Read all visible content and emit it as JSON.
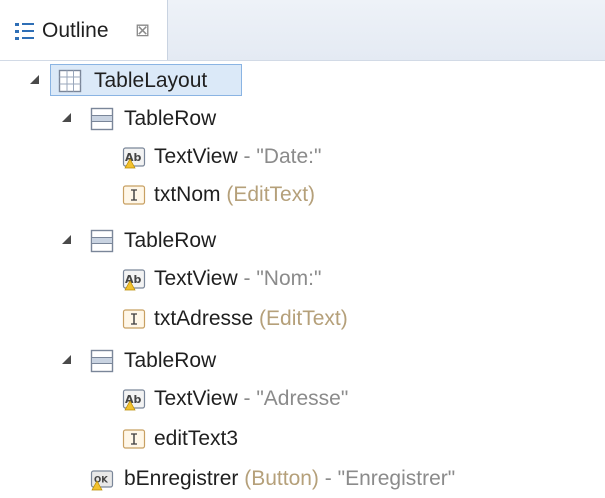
{
  "outline_view": {
    "tab": {
      "title": "Outline",
      "close_glyph": "⊠",
      "icon": "outline-icon"
    },
    "tree": {
      "root": {
        "label": "TableLayout",
        "icon": "table-layout-icon",
        "selected": true
      },
      "rows": [
        {
          "label": "TableRow",
          "icon": "table-row-icon",
          "children": [
            {
              "name": "TextView",
              "sep": " - ",
              "detail": "\"Date:\"",
              "icon": "textview-warning-icon"
            },
            {
              "name": "txtNom",
              "type": " (EditText)",
              "icon": "edittext-icon"
            }
          ]
        },
        {
          "label": "TableRow",
          "icon": "table-row-icon",
          "children": [
            {
              "name": "TextView",
              "sep": " - ",
              "detail": "\"Nom:\"",
              "icon": "textview-warning-icon"
            },
            {
              "name": "txtAdresse",
              "type": " (EditText)",
              "icon": "edittext-icon"
            }
          ]
        },
        {
          "label": "TableRow",
          "icon": "table-row-icon",
          "children": [
            {
              "name": "TextView",
              "sep": " - ",
              "detail": "\"Adresse\"",
              "icon": "textview-warning-icon"
            },
            {
              "name": "editText3",
              "icon": "edittext-icon"
            }
          ]
        }
      ],
      "button": {
        "name": "bEnregistrer",
        "type": " (Button)",
        "sep": " - ",
        "detail": "\"Enregistrer\"",
        "icon": "button-warning-icon"
      }
    }
  },
  "colors": {
    "type_text": "#b5a07a",
    "detail_text": "#8b8b8b",
    "selection": "#dbe9f8"
  }
}
